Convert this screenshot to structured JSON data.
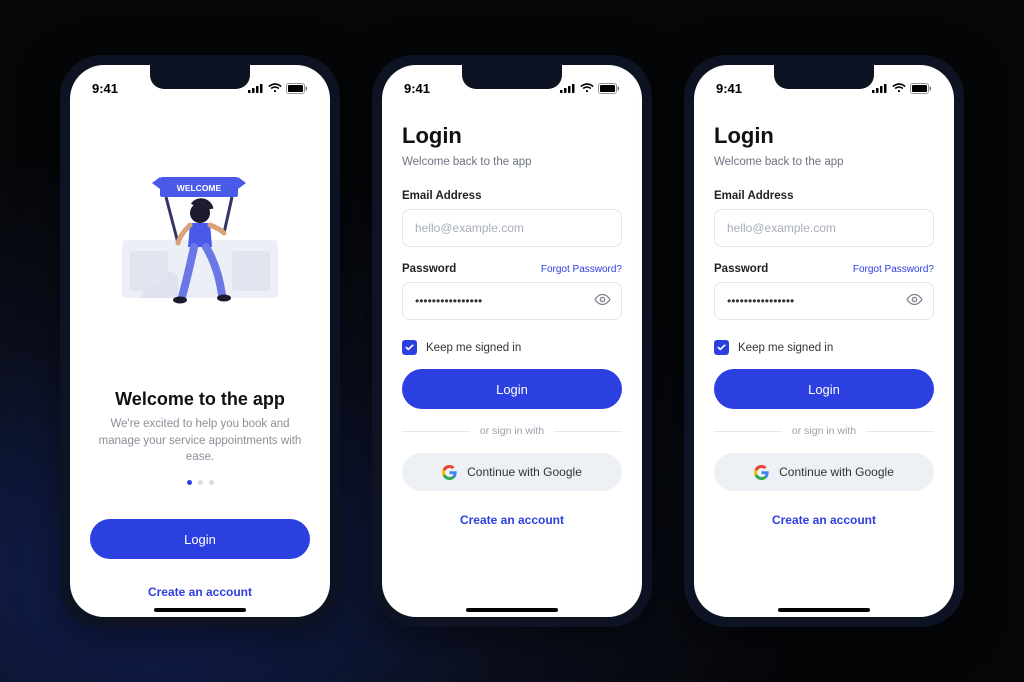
{
  "status_time": "9:41",
  "welcome": {
    "banner_text": "WELCOME",
    "title": "Welcome to the app",
    "subtitle": "We're excited to help you book and manage your service appointments with ease.",
    "login_button": "Login",
    "create_account": "Create an account"
  },
  "login": {
    "title": "Login",
    "subtitle": "Welcome back to the app",
    "email_label": "Email Address",
    "email_placeholder": "hello@example.com",
    "password_label": "Password",
    "password_value": "••••••••••••••••",
    "forgot": "Forgot Password?",
    "keep_signed": "Keep me signed in",
    "login_button": "Login",
    "or_text": "or sign in with",
    "google_button": "Continue with Google",
    "create_account": "Create an account"
  },
  "colors": {
    "primary": "#2c3fe0",
    "muted": "#8a8f99"
  }
}
